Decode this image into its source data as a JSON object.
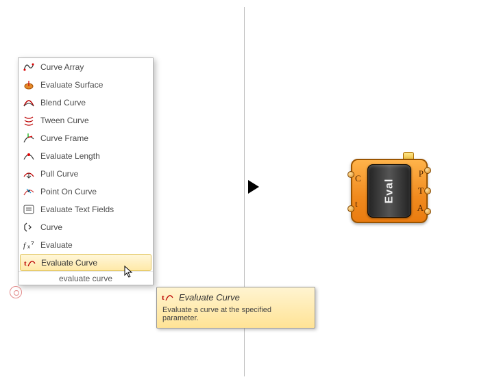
{
  "menu": {
    "items": [
      {
        "label": "Curve Array",
        "icon": "curve-array-icon"
      },
      {
        "label": "Evaluate Surface",
        "icon": "evaluate-surface-icon"
      },
      {
        "label": "Blend Curve",
        "icon": "blend-curve-icon"
      },
      {
        "label": "Tween Curve",
        "icon": "tween-curve-icon"
      },
      {
        "label": "Curve Frame",
        "icon": "curve-frame-icon"
      },
      {
        "label": "Evaluate Length",
        "icon": "evaluate-length-icon"
      },
      {
        "label": "Pull Curve",
        "icon": "pull-curve-icon"
      },
      {
        "label": "Point On Curve",
        "icon": "point-on-curve-icon"
      },
      {
        "label": "Evaluate Text Fields",
        "icon": "evaluate-text-icon"
      },
      {
        "label": "Curve",
        "icon": "curve-icon"
      },
      {
        "label": "Evaluate",
        "icon": "evaluate-fx-icon"
      },
      {
        "label": "Evaluate Curve",
        "icon": "evaluate-curve-icon"
      }
    ],
    "selected_index": 11,
    "search_text": "evaluate curve"
  },
  "tooltip": {
    "title": "Evaluate Curve",
    "description": "Evaluate a curve at the specified parameter."
  },
  "component": {
    "name": "Eval",
    "inputs": [
      "C",
      "t"
    ],
    "outputs": [
      "P",
      "T",
      "A"
    ]
  }
}
